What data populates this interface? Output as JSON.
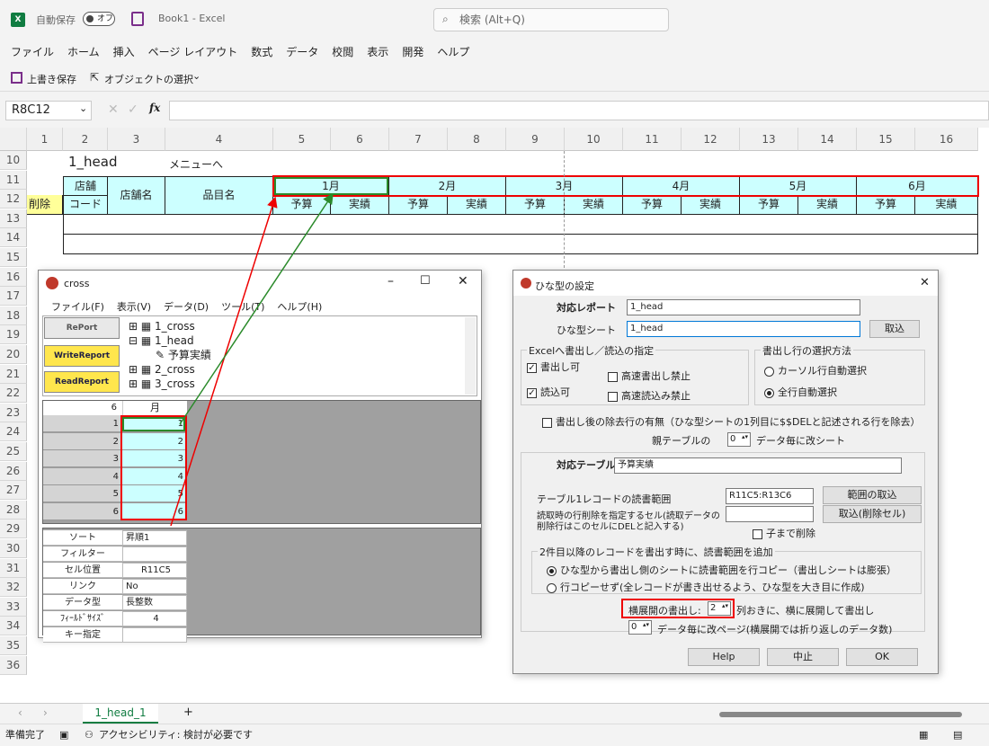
{
  "title": {
    "autosave": "自動保存",
    "toggle": "オフ",
    "doc": "Book1 - Excel",
    "search": "検索 (Alt+Q)"
  },
  "menu": [
    "ファイル",
    "ホーム",
    "挿入",
    "ページ レイアウト",
    "数式",
    "データ",
    "校閲",
    "表示",
    "開発",
    "ヘルプ"
  ],
  "qat": {
    "save": "上書き保存",
    "select": "オブジェクトの選択",
    "more": "⌄"
  },
  "namebox": "R8C12",
  "fx": "fx",
  "cols": [
    "1",
    "2",
    "3",
    "4",
    "5",
    "6",
    "7",
    "8",
    "9",
    "10",
    "11",
    "12",
    "13",
    "14",
    "15",
    "16"
  ],
  "rows": [
    "10",
    "11",
    "12",
    "13",
    "14",
    "15",
    "16",
    "17",
    "18",
    "19",
    "20",
    "21",
    "22",
    "23",
    "24",
    "25",
    "26",
    "27",
    "28",
    "29",
    "30",
    "31",
    "32",
    "33",
    "34",
    "35",
    "36"
  ],
  "sheet": {
    "title": "1_head",
    "menulink": "メニューへ",
    "h_store": "店舗",
    "h_code": "コード",
    "h_storename": "店舗名",
    "h_item": "品目名",
    "h_del": "削除",
    "months": [
      "1月",
      "2月",
      "3月",
      "4月",
      "5月",
      "6月"
    ],
    "budget": "予算",
    "actual": "実績"
  },
  "cross": {
    "title": "cross",
    "menu": [
      "ファイル(F)",
      "表示(V)",
      "データ(D)",
      "ツール(T)",
      "ヘルプ(H)"
    ],
    "tree": [
      "1_cross",
      "1_head",
      "予算実績",
      "2_cross",
      "3_cross"
    ],
    "btn1": "RePort",
    "btn2": "WriteReport",
    "btn3": "ReadReport",
    "grid_head_num": "6",
    "grid_head_label": "月",
    "grid_rows": [
      "1",
      "2",
      "3",
      "4",
      "5",
      "6"
    ],
    "props": [
      {
        "k": "ソート",
        "v": "昇順1"
      },
      {
        "k": "フィルター",
        "v": ""
      },
      {
        "k": "セル位置",
        "v": "R11C5"
      },
      {
        "k": "リンク",
        "v": "No"
      },
      {
        "k": "データ型",
        "v": "長整数"
      },
      {
        "k": "ﾌｨｰﾙﾄﾞｻｲｽﾞ",
        "v": "4"
      },
      {
        "k": "キー指定",
        "v": ""
      }
    ]
  },
  "hina": {
    "title": "ひな型の設定",
    "report_l": "対応レポート",
    "report_v": "1_head",
    "sheet_l": "ひな型シート",
    "sheet_v": "1_head",
    "load": "取込",
    "g1": "Excelへ書出し／読込の指定",
    "write": "書出し可",
    "fastwrite": "高速書出し禁止",
    "read": "読込可",
    "fastread": "高速読込み禁止",
    "g2": "書出し行の選択方法",
    "r_cursor": "カーソル行自動選択",
    "r_all": "全行自動選択",
    "delrow": "書出し後の除去行の有無（ひな型シートの1列目に$$DELと記述される行を除去）",
    "parent_l": "親テーブルの",
    "parent_v": "0",
    "parent_r": "データ毎に改シート",
    "table_l": "対応テーブル",
    "table_v": "予算実績",
    "range_l": "テーブル1レコードの読書範囲",
    "range_v": "R11C5:R13C6",
    "range_btn": "範囲の取込",
    "delcell_l1": "読取時の行削除を指定するセル(読取データの",
    "delcell_l2": "削除行はこのセルにDELと記入する)",
    "delcell_btn": "取込(削除セル)",
    "child": "子まで削除",
    "g3": "2件目以降のレコードを書出す時に、読書範囲を追加",
    "opt1": "ひな型から書出し側のシートに読書範囲を行コピー（書出しシートは膨張）",
    "opt2": "行コピーせず(全レコードが書き出せるよう、ひな型を大き目に作成)",
    "horiz_l": "横展開の書出し:",
    "horiz_v": "2",
    "horiz_r": "列おきに、横に展開して書出し",
    "page_v": "0",
    "page_r": "データ毎に改ページ(横展開では折り返しのデータ数)",
    "help": "Help",
    "cancel": "中止",
    "ok": "OK"
  },
  "tabs": {
    "sheet": "1_head_1",
    "add": "+"
  },
  "status": {
    "ready": "準備完了",
    "access": "アクセシビリティ: 検討が必要です"
  }
}
